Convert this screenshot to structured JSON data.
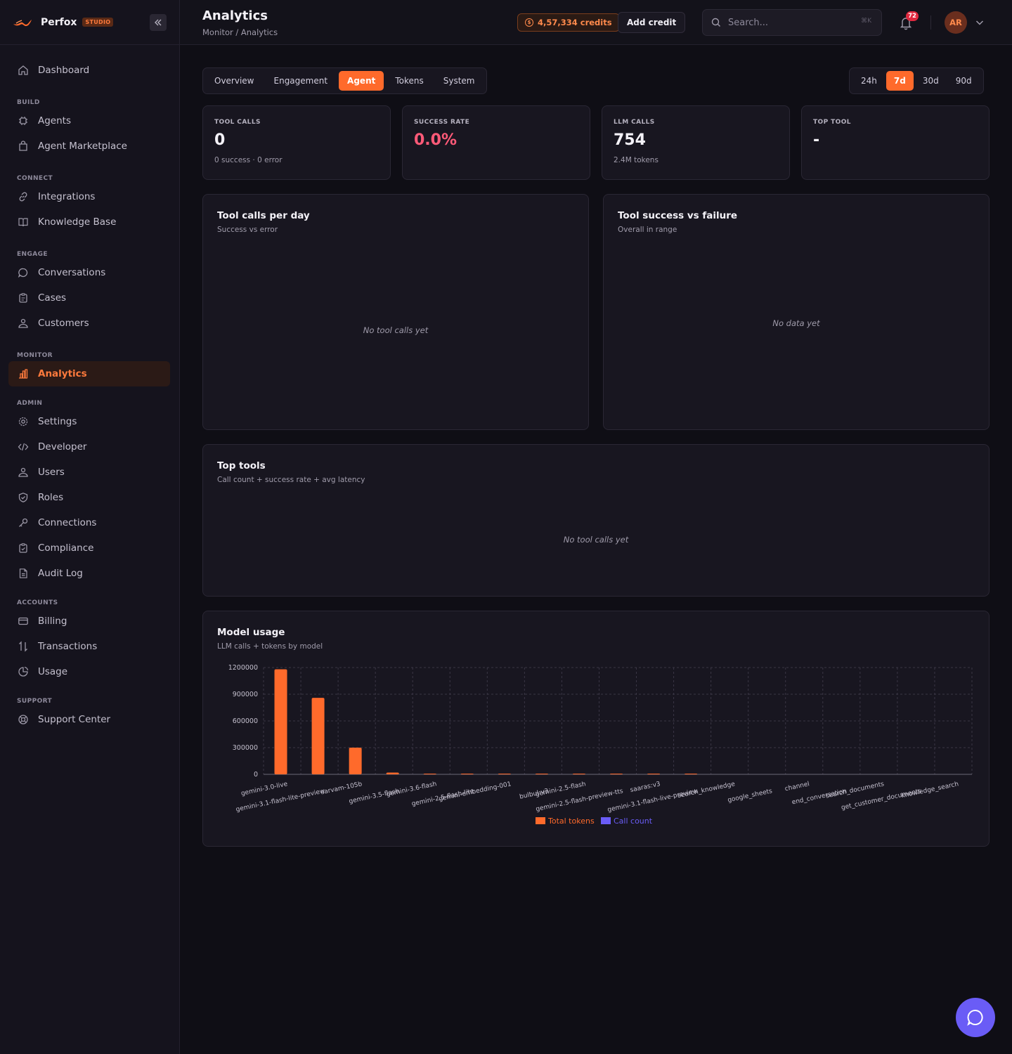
{
  "brand": {
    "name": "Perfox",
    "badge": "STUDIO"
  },
  "sidebar": {
    "items": {
      "dashboard": "Dashboard",
      "section_build": "BUILD",
      "agents": "Agents",
      "agent_marketplace": "Agent Marketplace",
      "section_connect": "CONNECT",
      "integrations": "Integrations",
      "knowledge_base": "Knowledge Base",
      "section_engage": "ENGAGE",
      "conversations": "Conversations",
      "cases": "Cases",
      "customers": "Customers",
      "section_monitor": "MONITOR",
      "analytics": "Analytics",
      "section_admin": "ADMIN",
      "settings": "Settings",
      "developer": "Developer",
      "users": "Users",
      "roles": "Roles",
      "connections": "Connections",
      "compliance": "Compliance",
      "audit_log": "Audit Log",
      "section_accounts": "ACCOUNTS",
      "billing": "Billing",
      "transactions": "Transactions",
      "usage": "Usage",
      "section_support": "SUPPORT",
      "support_center": "Support Center"
    }
  },
  "header": {
    "title": "Analytics",
    "breadcrumb": "Monitor / Analytics",
    "credits": "4,57,334 credits",
    "add_credit": "Add credit",
    "search_placeholder": "Search...",
    "search_shortcut": "⌘K",
    "notifications": "72",
    "avatar_initials": "AR"
  },
  "tabs": [
    "Overview",
    "Engagement",
    "Agent",
    "Tokens",
    "System"
  ],
  "active_tab": "Agent",
  "ranges": [
    "24h",
    "7d",
    "30d",
    "90d"
  ],
  "active_range": "7d",
  "stats": [
    {
      "label": "TOOL CALLS",
      "value": "0",
      "sub": "0 success · 0 error"
    },
    {
      "label": "SUCCESS RATE",
      "value": "0.0%",
      "sub": ""
    },
    {
      "label": "LLM CALLS",
      "value": "754",
      "sub": "2.4M tokens"
    },
    {
      "label": "TOP TOOL",
      "value": "-",
      "sub": ""
    }
  ],
  "panels": {
    "tool_calls_per_day": {
      "title": "Tool calls per day",
      "subtitle": "Success vs error",
      "empty": "No tool calls yet"
    },
    "tool_success": {
      "title": "Tool success vs failure",
      "subtitle": "Overall in range",
      "empty": "No data yet"
    },
    "top_tools": {
      "title": "Top tools",
      "subtitle": "Call count + success rate + avg latency",
      "empty": "No tool calls yet"
    },
    "model_usage": {
      "title": "Model usage",
      "subtitle": "LLM calls + tokens by model"
    }
  },
  "colors": {
    "accent": "#ff6a2b",
    "call_count": "#6a5cf6",
    "danger": "#ff5a78"
  },
  "chart_data": {
    "type": "bar",
    "title": "Model usage",
    "subtitle": "LLM calls + tokens by model",
    "categories": [
      "gemini-3.0-live",
      "gemini-3.1-flash-lite-preview",
      "sarvam-105b",
      "gemini-3.5-flash",
      "gemini-3.6-flash",
      "gemini-2.5-flash-lite",
      "gemini-embedding-001",
      "bulbul:v3",
      "gemini-2.5-flash",
      "gemini-2.5-flash-preview-tts",
      "saaras:v3",
      "gemini-3.1-flash-live-preview",
      "search_knowledge",
      "google_sheets",
      "channel",
      "end_conversation",
      "search_documents",
      "get_customer_documents",
      "knowledge_search"
    ],
    "series": [
      {
        "name": "Total tokens",
        "values": [
          1180000,
          860000,
          300000,
          20000,
          6000,
          4000,
          3000,
          500,
          300,
          200,
          100,
          100,
          0,
          0,
          0,
          0,
          0,
          0,
          0
        ]
      },
      {
        "name": "Call count",
        "values": [
          0,
          0,
          0,
          0,
          0,
          0,
          0,
          0,
          0,
          0,
          0,
          0,
          0,
          0,
          0,
          0,
          0,
          0,
          0
        ]
      }
    ],
    "yticks": [
      "0",
      "300000",
      "600000",
      "900000",
      "1200000"
    ],
    "ylim": [
      0,
      1200000
    ],
    "grid": true,
    "legend": "bottom"
  }
}
